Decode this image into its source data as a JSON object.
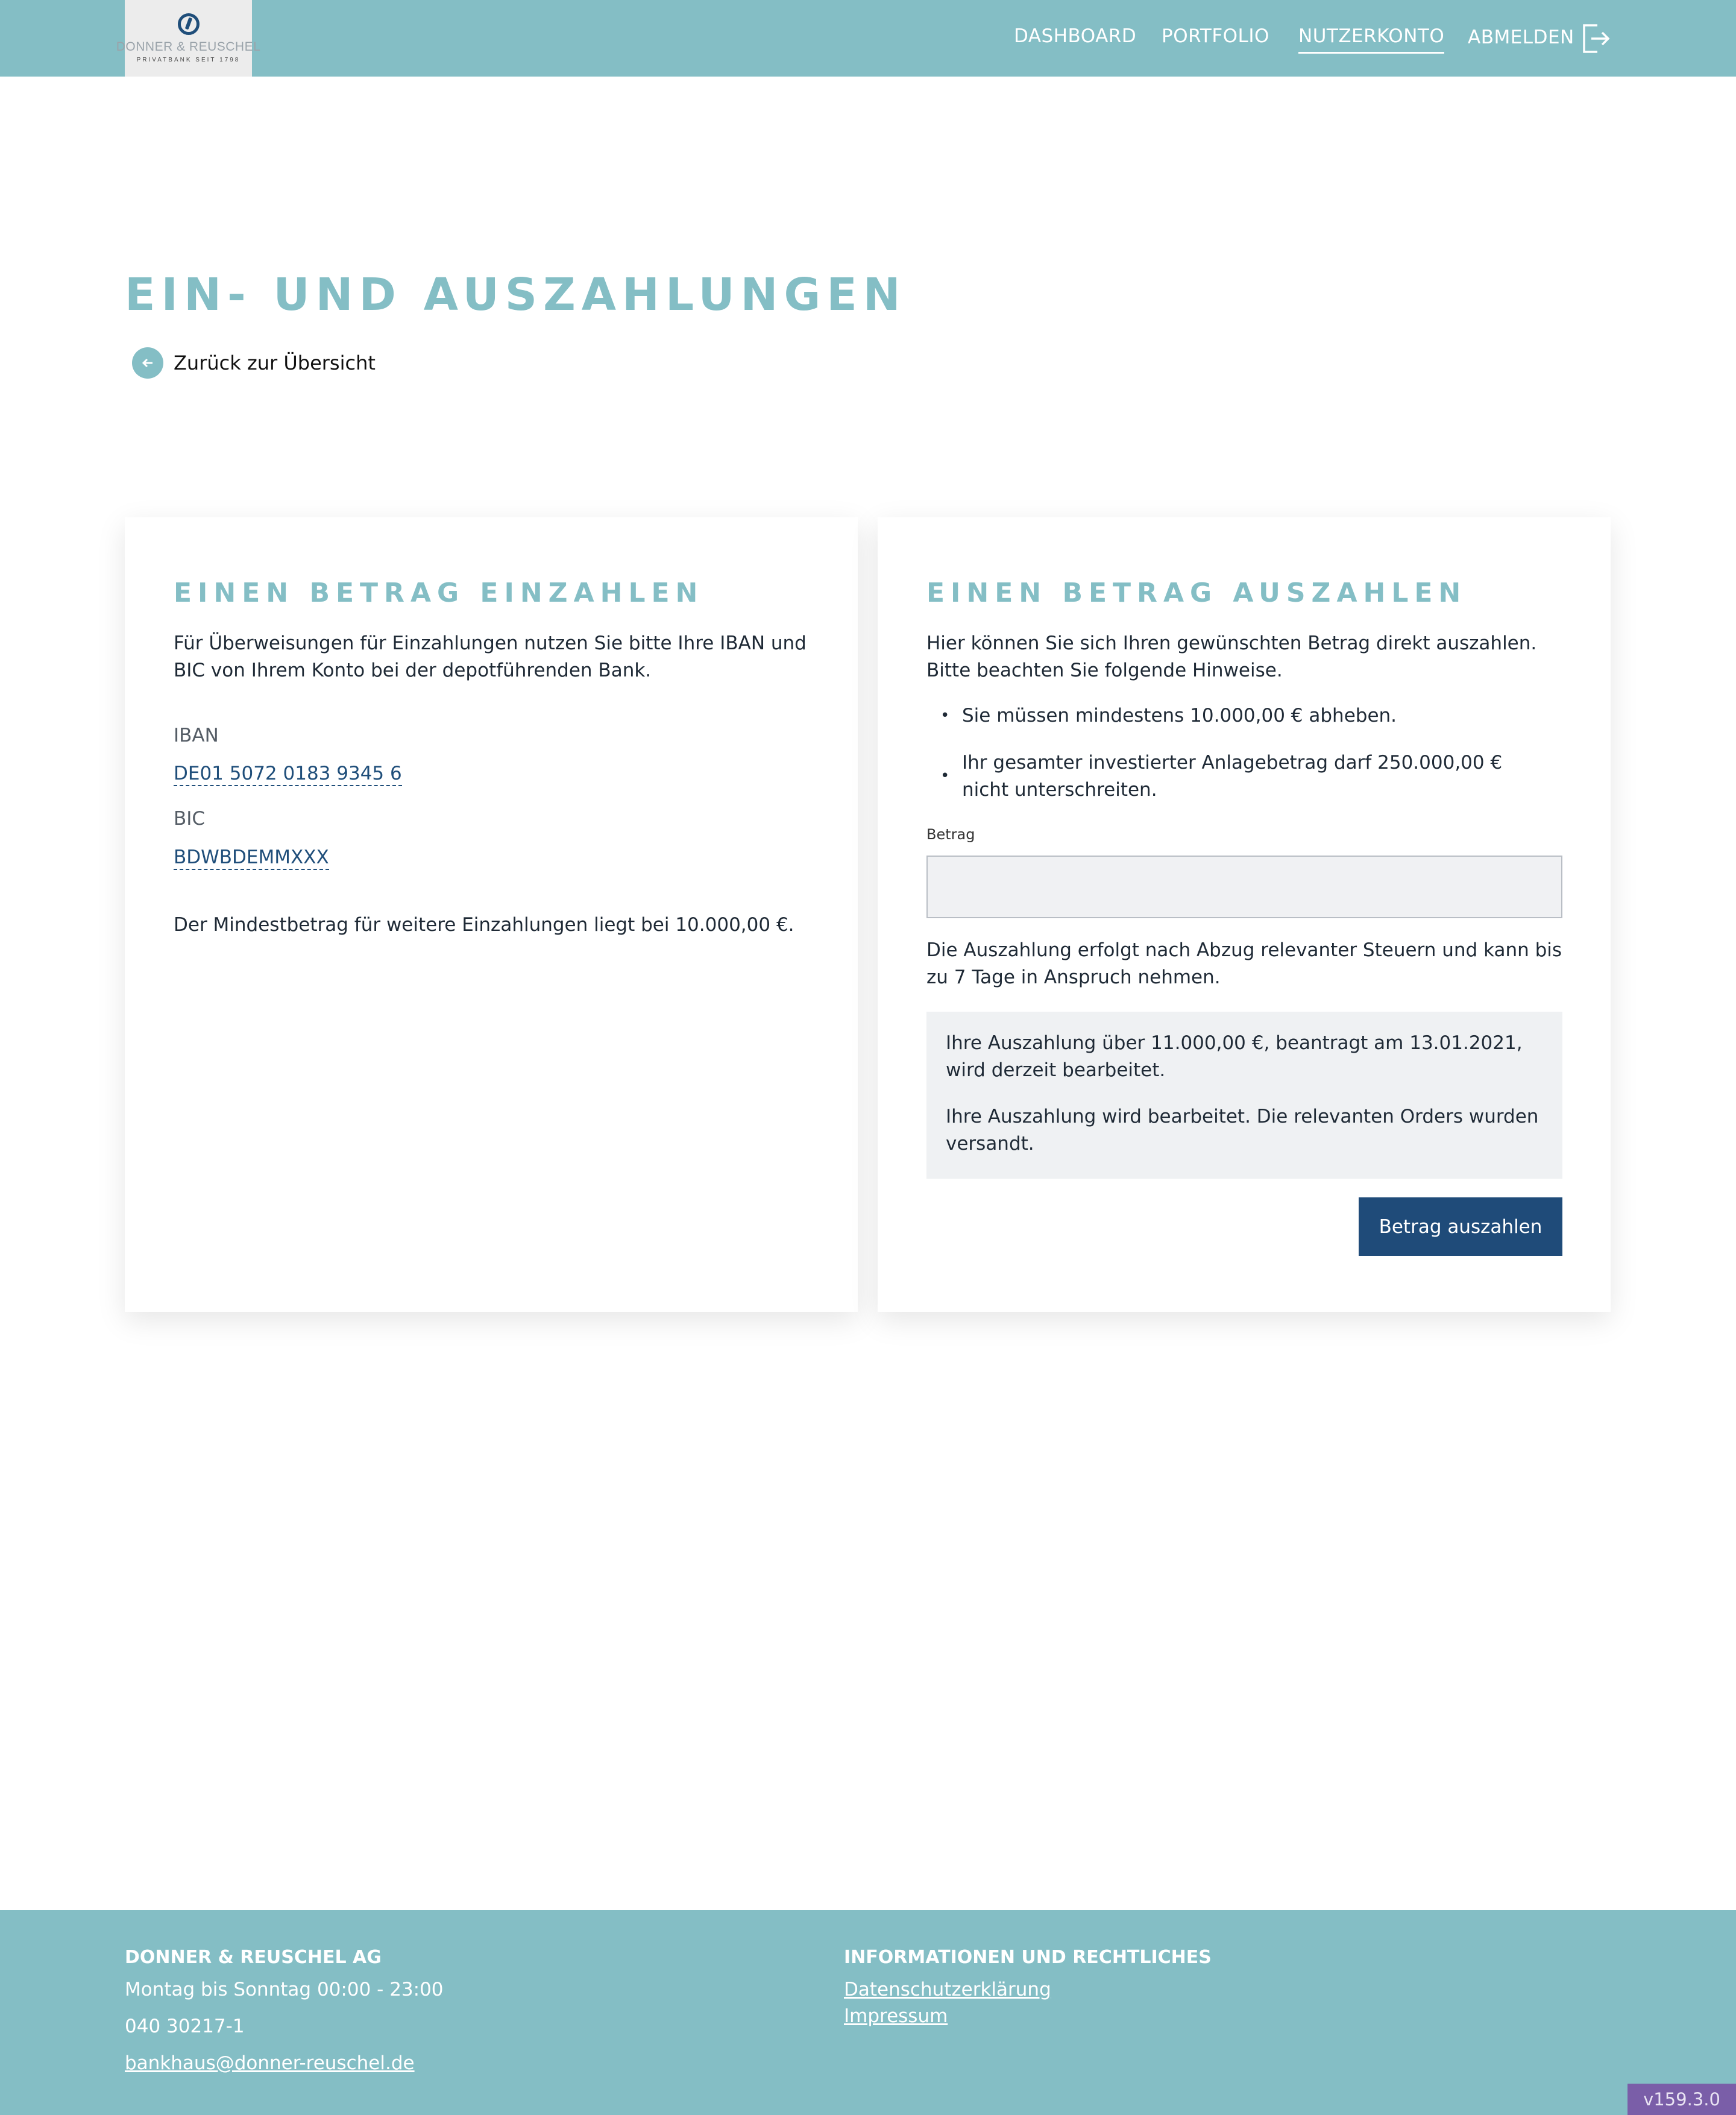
{
  "header": {
    "logo": {
      "name": "DONNER & REUSCHEL",
      "subtitle": "PRIVATBANK SEIT 1798"
    },
    "nav": {
      "dashboard": "DASHBOARD",
      "portfolio": "PORTFOLIO",
      "account": "NUTZERKONTO",
      "logout": "ABMELDEN",
      "active": "NUTZERKONTO"
    }
  },
  "page": {
    "title": "EIN- UND AUSZAHLUNGEN",
    "back_link": "Zurück zur Übersicht"
  },
  "deposit": {
    "title": "EINEN BETRAG EINZAHLEN",
    "intro": "Für Überweisungen für Einzahlungen nutzen Sie bitte Ihre IBAN und BIC von Ihrem Konto bei der depotführenden Bank.",
    "iban_label": "IBAN",
    "iban_value": "DE01 5072 0183 9345 6",
    "bic_label": "BIC",
    "bic_value": "BDWBDEMMXXX",
    "minimum_note": "Der Mindestbetrag für weitere Einzahlungen liegt bei 10.000,00 €."
  },
  "withdraw": {
    "title": "EINEN BETRAG AUSZAHLEN",
    "intro": "Hier können Sie sich Ihren gewünschten Betrag direkt auszahlen. Bitte beachten Sie folgende Hinweise.",
    "bullets": [
      "Sie müssen mindestens 10.000,00 € abheben.",
      "Ihr gesamter investierter Anlagebetrag darf 250.000,00 € nicht unterschreiten."
    ],
    "amount_label": "Betrag",
    "amount_value": "",
    "processing_note": "Die Auszahlung erfolgt nach Abzug relevanter Steuern und kann bis zu 7 Tage in Anspruch nehmen.",
    "status_lines": [
      "Ihre Auszahlung über 11.000,00 €, beantragt am 13.01.2021, wird derzeit bearbeitet.",
      "Ihre Auszahlung wird bearbeitet. Die relevanten Orders wurden versandt."
    ],
    "submit_label": "Betrag auszahlen"
  },
  "footer": {
    "company": "DONNER & REUSCHEL AG",
    "hours": "Montag bis Sonntag 00:00 - 23:00",
    "phone": "040 30217-1",
    "email": "bankhaus@donner-reuschel.de",
    "info_heading": "INFORMATIONEN UND RECHTLICHES",
    "privacy": "Datenschutzerklärung",
    "imprint": "Impressum"
  },
  "version": "v159.3.0",
  "colors": {
    "brand_teal": "#84bec5",
    "button_navy": "#1f4b79",
    "version_purple": "#7a5ea8"
  },
  "icons": {
    "logout": "logout-icon",
    "back": "arrow-left-icon"
  }
}
